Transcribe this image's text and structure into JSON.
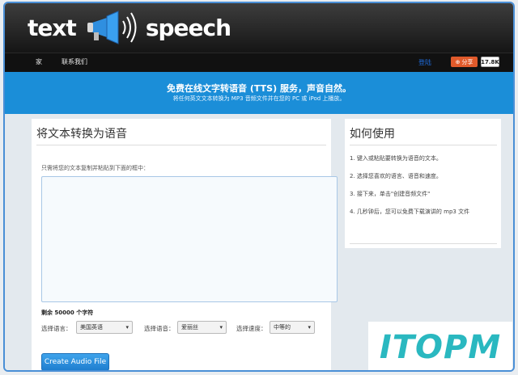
{
  "logo": {
    "text_left": "text",
    "text_right": "speech",
    "icon": "megaphone-icon"
  },
  "nav": {
    "home": "家",
    "contact": "联系我们",
    "login": "登陆",
    "share": "分享",
    "share_count": "17.8K"
  },
  "banner": {
    "title": "免费在线文字转语音 (TTS) 服务，声音自然。",
    "subtitle": "将任何英文文本转换为 MP3 音频文件并在您的 PC 或 iPod 上播放。"
  },
  "converter": {
    "title": "将文本转换为语音",
    "instruction": "只需将您的文本复制并粘贴到下面的框中：",
    "textarea_value": "",
    "remaining": "剩余 50000 个字符",
    "language_label": "选择语言：",
    "language_value": "美国英语",
    "voice_label": "选择语音：",
    "voice_value": "爱丽丝",
    "speed_label": "选择速度：",
    "speed_value": "中等的",
    "create_button": "Create Audio File"
  },
  "howto": {
    "title": "如何使用",
    "steps": [
      "1. 键入或粘贴要转换为语音的文本。",
      "2. 选择您喜欢的语言、语音和速度。",
      "3. 接下来，单击\"创建音频文件\"",
      "4. 几秒钟后，您可以免费下载演讲的 mp3 文件"
    ]
  },
  "watermark": {
    "text": "ITOPM"
  },
  "colors": {
    "banner": "#1b8ed8",
    "button": "#2a8fdc",
    "watermark": "#2ab8c0",
    "header": "#222222"
  }
}
